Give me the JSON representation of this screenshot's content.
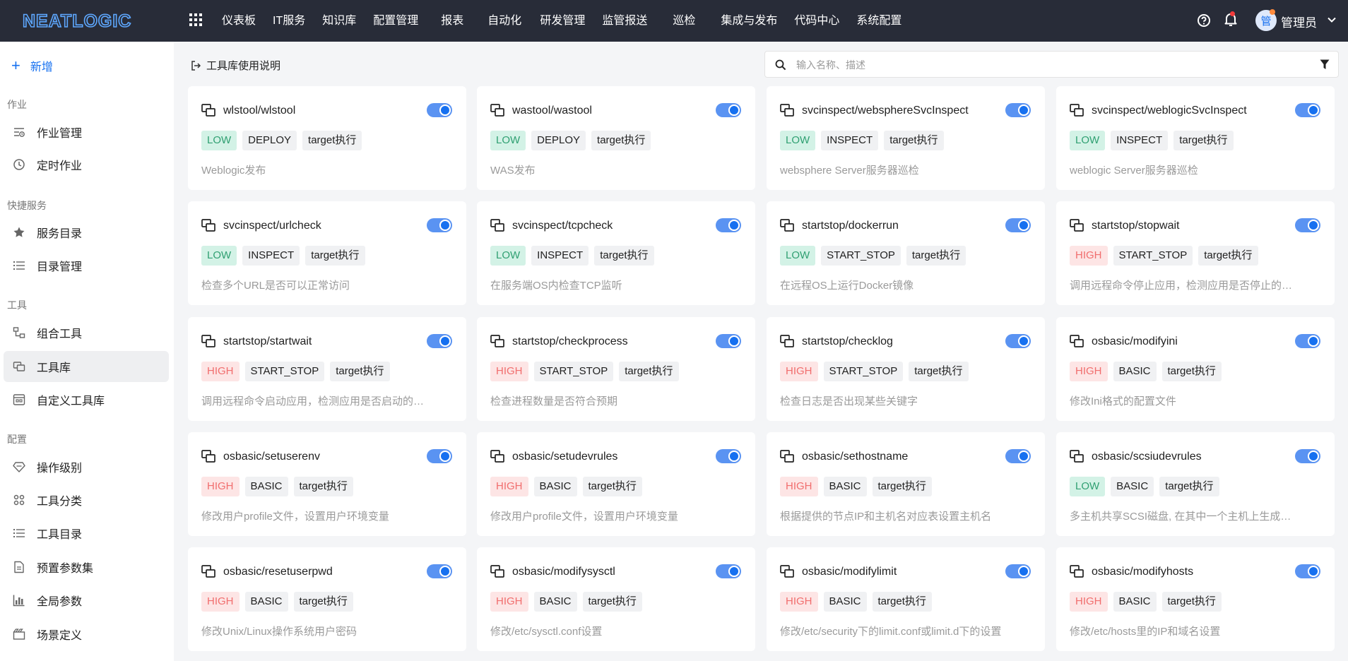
{
  "app": {
    "logo_text": "NEATLOGIC",
    "nav": [
      "仪表板",
      "IT服务",
      "知识库",
      "配置管理",
      "报表",
      "自动化",
      "研发管理",
      "监管报送",
      "巡检",
      "集成与发布",
      "代码中心",
      "系统配置"
    ],
    "user": {
      "avatar_text": "管",
      "name": "管理员"
    }
  },
  "sidebar": {
    "add_label": "新增",
    "groups": [
      {
        "title": "作业",
        "items": [
          {
            "label": "作业管理",
            "icon": "job-list-icon"
          },
          {
            "label": "定时作业",
            "icon": "clock-icon"
          }
        ]
      },
      {
        "title": "快捷服务",
        "items": [
          {
            "label": "服务目录",
            "icon": "star-icon"
          },
          {
            "label": "目录管理",
            "icon": "list-icon"
          }
        ]
      },
      {
        "title": "工具",
        "items": [
          {
            "label": "组合工具",
            "icon": "combine-icon"
          },
          {
            "label": "工具库",
            "icon": "toolbox-icon",
            "active": true
          },
          {
            "label": "自定义工具库",
            "icon": "custom-toolbox-icon"
          }
        ]
      },
      {
        "title": "配置",
        "items": [
          {
            "label": "操作级别",
            "icon": "level-icon"
          },
          {
            "label": "工具分类",
            "icon": "category-icon"
          },
          {
            "label": "工具目录",
            "icon": "list-icon"
          },
          {
            "label": "预置参数集",
            "icon": "document-icon"
          },
          {
            "label": "全局参数",
            "icon": "chart-icon"
          },
          {
            "label": "场景定义",
            "icon": "scene-icon"
          }
        ]
      }
    ]
  },
  "main": {
    "help_link": "工具库使用说明",
    "search_placeholder": "输入名称、描述",
    "cards": [
      {
        "title": "wlstool/wlstool",
        "risk": "LOW",
        "type": "DEPLOY",
        "exec": "target执行",
        "desc": "Weblogic发布",
        "enabled": true
      },
      {
        "title": "wastool/wastool",
        "risk": "LOW",
        "type": "DEPLOY",
        "exec": "target执行",
        "desc": "WAS发布",
        "enabled": true
      },
      {
        "title": "svcinspect/websphereSvcInspect",
        "risk": "LOW",
        "type": "INSPECT",
        "exec": "target执行",
        "desc": "websphere Server服务器巡检",
        "enabled": true
      },
      {
        "title": "svcinspect/weblogicSvcInspect",
        "risk": "LOW",
        "type": "INSPECT",
        "exec": "target执行",
        "desc": "weblogic Server服务器巡检",
        "enabled": true
      },
      {
        "title": "svcinspect/urlcheck",
        "risk": "LOW",
        "type": "INSPECT",
        "exec": "target执行",
        "desc": "检查多个URL是否可以正常访问",
        "enabled": true
      },
      {
        "title": "svcinspect/tcpcheck",
        "risk": "LOW",
        "type": "INSPECT",
        "exec": "target执行",
        "desc": "在服务端OS内检查TCP监听",
        "enabled": true
      },
      {
        "title": "startstop/dockerrun",
        "risk": "LOW",
        "type": "START_STOP",
        "exec": "target执行",
        "desc": "在远程OS上运行Docker镜像",
        "enabled": true
      },
      {
        "title": "startstop/stopwait",
        "risk": "HIGH",
        "type": "START_STOP",
        "exec": "target执行",
        "desc": "调用远程命令停止应用，检测应用是否停止的…",
        "enabled": true
      },
      {
        "title": "startstop/startwait",
        "risk": "HIGH",
        "type": "START_STOP",
        "exec": "target执行",
        "desc": "调用远程命令启动应用，检测应用是否启动的…",
        "enabled": true
      },
      {
        "title": "startstop/checkprocess",
        "risk": "HIGH",
        "type": "START_STOP",
        "exec": "target执行",
        "desc": "检查进程数量是否符合预期",
        "enabled": true
      },
      {
        "title": "startstop/checklog",
        "risk": "HIGH",
        "type": "START_STOP",
        "exec": "target执行",
        "desc": "检查日志是否出现某些关键字",
        "enabled": true
      },
      {
        "title": "osbasic/modifyini",
        "risk": "HIGH",
        "type": "BASIC",
        "exec": "target执行",
        "desc": "修改Ini格式的配置文件",
        "enabled": true
      },
      {
        "title": "osbasic/setuserenv",
        "risk": "HIGH",
        "type": "BASIC",
        "exec": "target执行",
        "desc": "修改用户profile文件，设置用户环境变量",
        "enabled": true
      },
      {
        "title": "osbasic/setudevrules",
        "risk": "HIGH",
        "type": "BASIC",
        "exec": "target执行",
        "desc": "修改用户profile文件，设置用户环境变量",
        "enabled": true
      },
      {
        "title": "osbasic/sethostname",
        "risk": "HIGH",
        "type": "BASIC",
        "exec": "target执行",
        "desc": "根据提供的节点IP和主机名对应表设置主机名",
        "enabled": true
      },
      {
        "title": "osbasic/scsiudevrules",
        "risk": "LOW",
        "type": "BASIC",
        "exec": "target执行",
        "desc": "多主机共享SCSI磁盘, 在其中一个主机上生成…",
        "enabled": true
      },
      {
        "title": "osbasic/resetuserpwd",
        "risk": "HIGH",
        "type": "BASIC",
        "exec": "target执行",
        "desc": "修改Unix/Linux操作系统用户密码",
        "enabled": true
      },
      {
        "title": "osbasic/modifysysctl",
        "risk": "HIGH",
        "type": "BASIC",
        "exec": "target执行",
        "desc": "修改/etc/sysctl.conf设置",
        "enabled": true
      },
      {
        "title": "osbasic/modifylimit",
        "risk": "HIGH",
        "type": "BASIC",
        "exec": "target执行",
        "desc": "修改/etc/security下的limit.conf或limit.d下的设置",
        "enabled": true
      },
      {
        "title": "osbasic/modifyhosts",
        "risk": "HIGH",
        "type": "BASIC",
        "exec": "target执行",
        "desc": "修改/etc/hosts里的IP和域名设置",
        "enabled": true
      }
    ]
  },
  "colors": {
    "topbar": "#282c38",
    "accent": "#1670f0",
    "low_bg": "#d3f2e6",
    "low_text": "#30a072",
    "high_bg": "#fde5e5",
    "high_text": "#f16e6e"
  }
}
